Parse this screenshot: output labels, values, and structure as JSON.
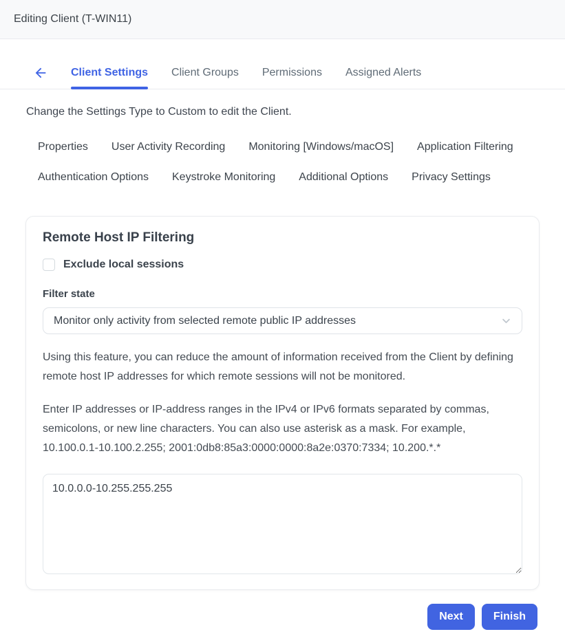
{
  "colors": {
    "accent_blue": "#4164e1",
    "topbar_bg": "#f8f9fa",
    "border": "#e9ebee"
  },
  "header": {
    "title": "Editing Client (T-WIN11)"
  },
  "tabs": {
    "back_icon": "arrow-left-icon",
    "items": [
      {
        "label": "Client Settings",
        "active": true
      },
      {
        "label": "Client Groups",
        "active": false
      },
      {
        "label": "Permissions",
        "active": false
      },
      {
        "label": "Assigned Alerts",
        "active": false
      }
    ]
  },
  "notice": "Change the Settings Type to Custom to edit the Client.",
  "subtabs": [
    "Properties",
    "User Activity Recording",
    "Monitoring [Windows/macOS]",
    "Application Filtering",
    "Authentication Options",
    "Keystroke Monitoring",
    "Additional Options",
    "Privacy Settings"
  ],
  "card": {
    "title": "Remote Host IP Filtering",
    "exclude_checkbox": {
      "label": "Exclude local sessions",
      "checked": false
    },
    "filter_state": {
      "label": "Filter state",
      "selected_option": "Monitor only activity from selected remote public IP addresses",
      "chevron_icon": "chevron-down-icon"
    },
    "description_1": "Using this feature, you can reduce the amount of information received from the Client by defining remote host IP addresses for which remote sessions will not be monitored.",
    "description_2": "Enter IP addresses or IP-address ranges in the IPv4 or IPv6 formats separated by commas, semicolons, or new line characters. You can also use asterisk as a mask. For example, 10.100.0.1-10.100.2.255; 2001:0db8:85a3:0000:0000:8a2e:0370:7334; 10.200.*.*",
    "ip_list_value": "10.0.0.0-10.255.255.255"
  },
  "footer": {
    "next_label": "Next",
    "finish_label": "Finish"
  }
}
